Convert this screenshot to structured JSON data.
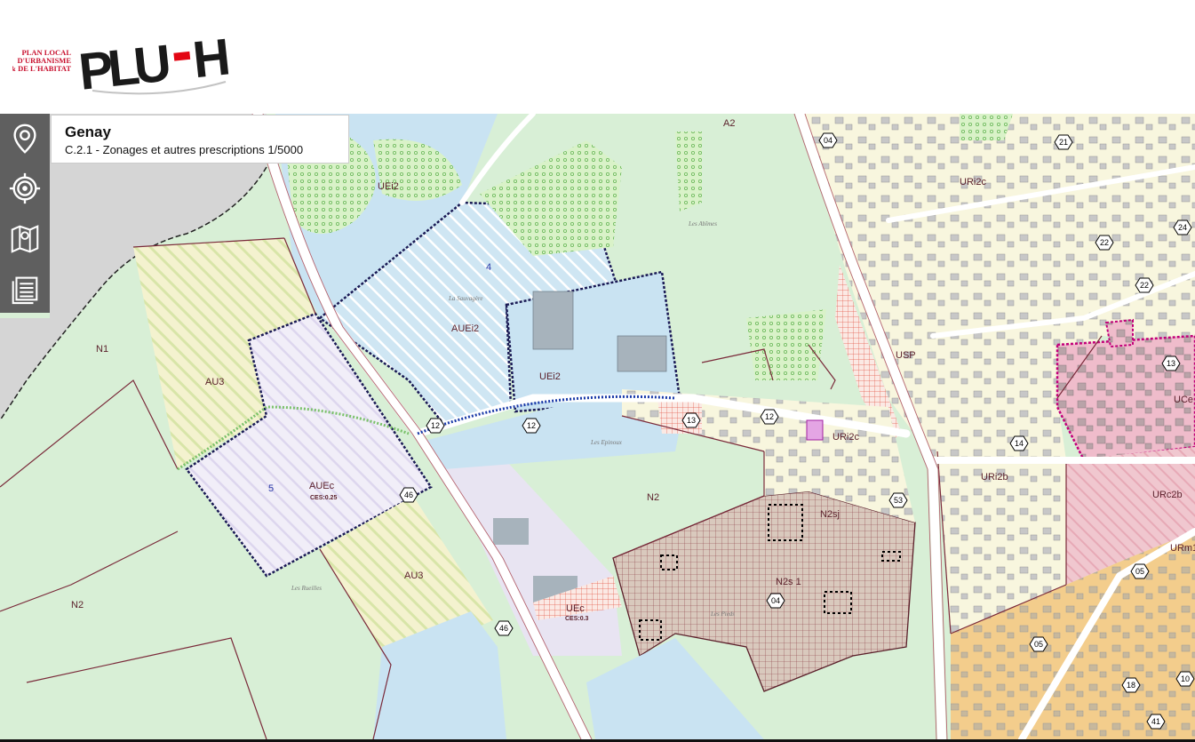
{
  "header": {
    "logo_small_text": [
      "PLAN LOCAL",
      "D'URBANISME",
      "& DE L'HABITAT"
    ],
    "logo_brand": "PLU-H",
    "brand_color": "#e30613"
  },
  "info": {
    "commune": "Genay",
    "layer": "C.2.1 - Zonages et autres prescriptions 1/5000"
  },
  "toolbar": {
    "items": [
      {
        "icon": "location-pin-icon"
      },
      {
        "icon": "target-icon"
      },
      {
        "icon": "map-layers-icon"
      },
      {
        "icon": "document-list-icon"
      }
    ]
  },
  "map": {
    "colors": {
      "natural_zone": "#d8efd6",
      "economic_zone": "#c9e3f2",
      "residential_zone": "#f8f6de",
      "central_zone": "#f1c7d6",
      "mixed_zone": "#f3cd8c",
      "hatch_zone": "#e8e4f2",
      "road": "#ffffff",
      "border": "#7a2a3a"
    },
    "zone_labels": [
      "A2",
      "UEi2",
      "4",
      "AUEi2",
      "UEi2",
      "N1",
      "AU3",
      "5",
      "AUEc",
      "CES:0.25",
      "AU3",
      "N2",
      "N2",
      "UEc",
      "CES:0.3",
      "N2sj",
      "N2s 1",
      "USP",
      "URi2c",
      "URi2c",
      "URi2b",
      "URc2b",
      "URm1",
      "UCe",
      "Les Abîmes",
      "La Sauvagère",
      "Les Epinoux",
      "Les Rueilles",
      "Les Pieds"
    ],
    "road_numbers": [
      "04",
      "21",
      "22",
      "24",
      "22",
      "12",
      "12",
      "12",
      "13",
      "13",
      "14",
      "46",
      "46",
      "53",
      "05",
      "05",
      "04",
      "18",
      "41",
      "10"
    ]
  }
}
